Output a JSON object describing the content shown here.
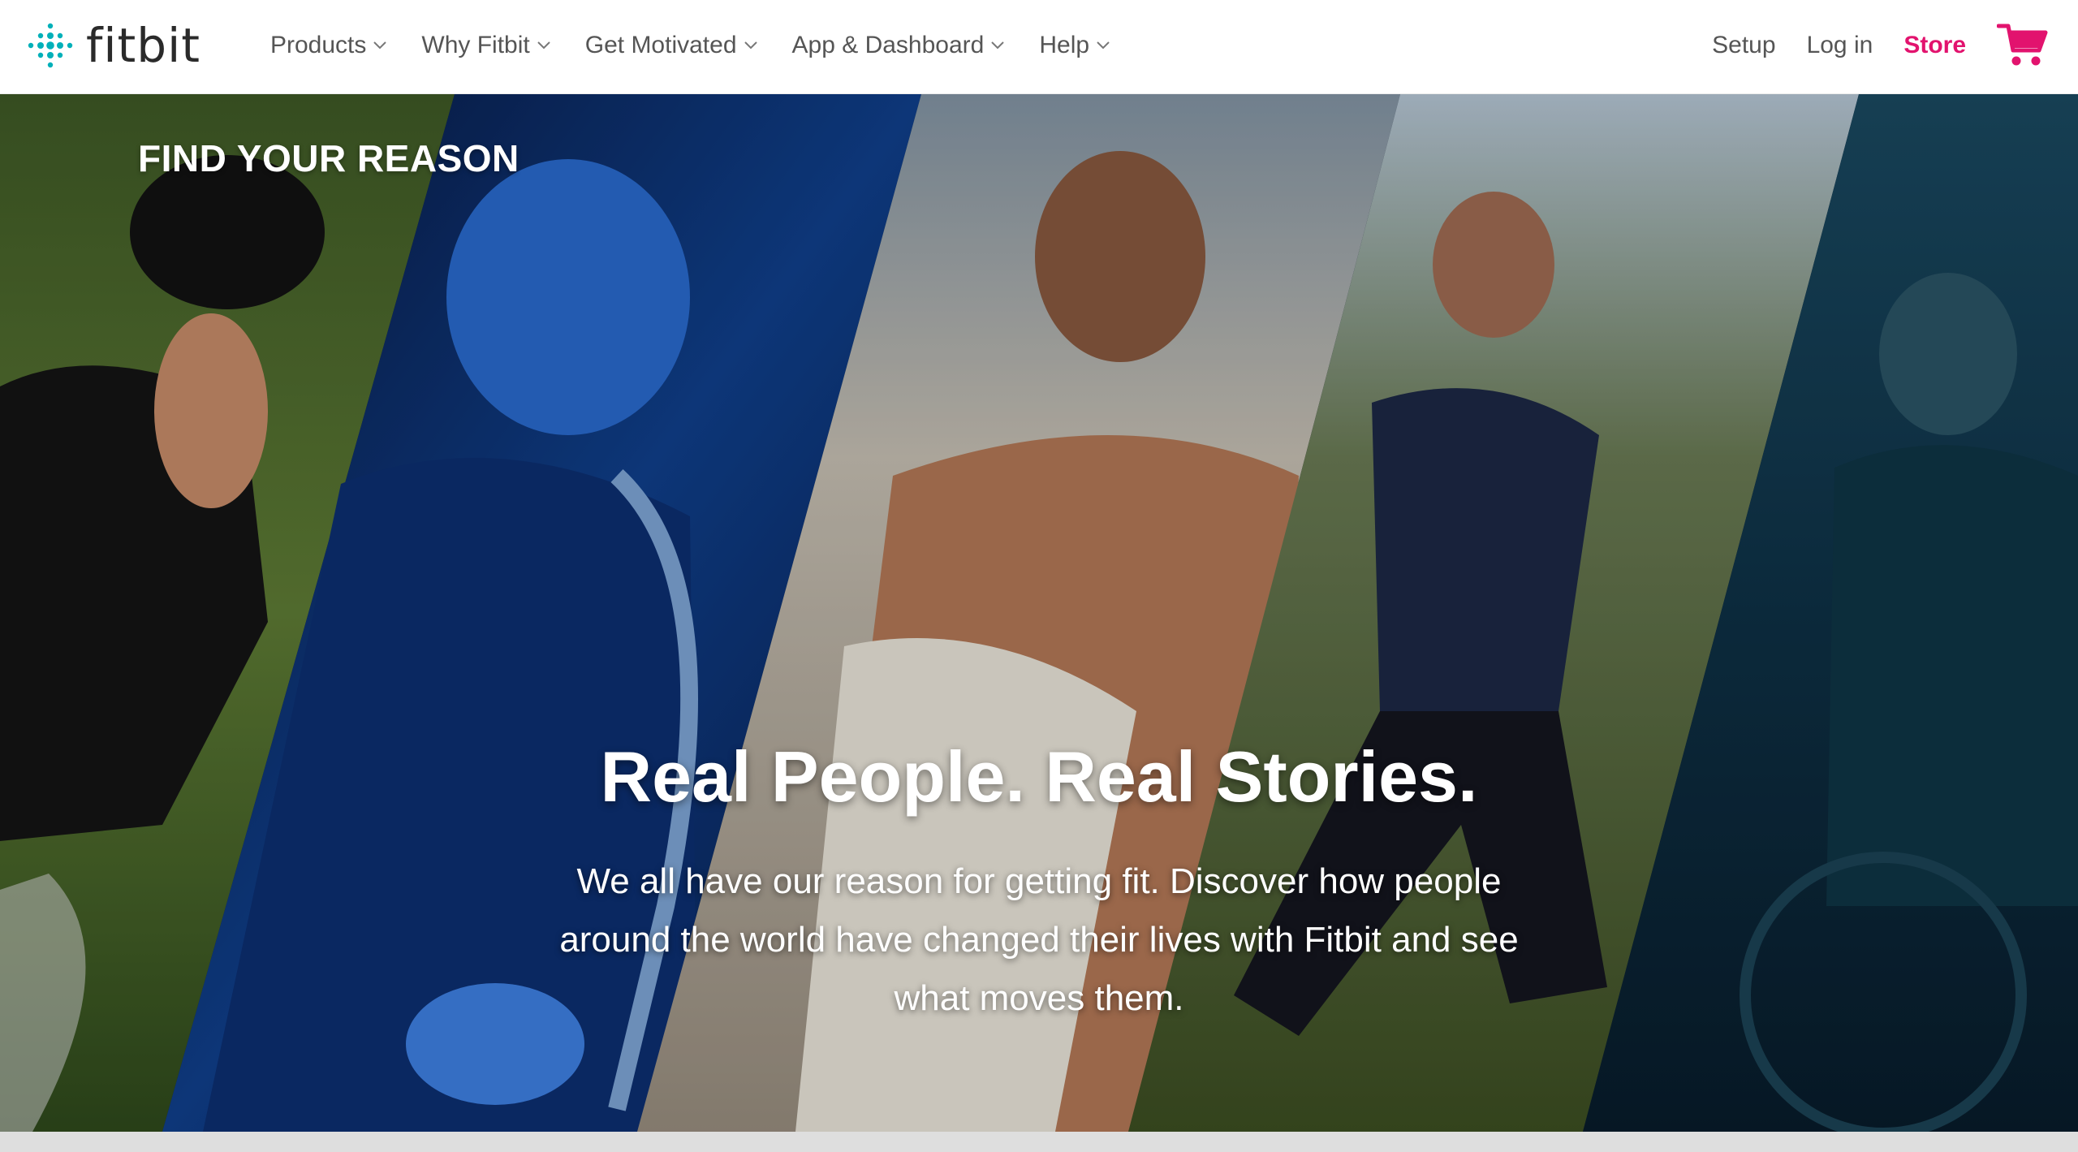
{
  "brand": {
    "name": "fitbit",
    "color": "#00b0b9"
  },
  "nav": {
    "items": [
      {
        "label": "Products"
      },
      {
        "label": "Why Fitbit"
      },
      {
        "label": "Get Motivated"
      },
      {
        "label": "App & Dashboard"
      },
      {
        "label": "Help"
      }
    ],
    "right": {
      "setup": "Setup",
      "login": "Log in",
      "store": "Store"
    },
    "store_color": "#e2136e",
    "cart_icon": "shopping-cart-icon",
    "dropdown_icon": "chevron-down-icon"
  },
  "hero": {
    "label": "FIND YOUR REASON",
    "title": "Real People. Real Stories.",
    "description": "We all have our reason for getting fit. Discover how people around the world have changed their lives with Fitbit and see what moves them.",
    "panels": [
      {
        "name": "cyclist-photo"
      },
      {
        "name": "saxophonist-photo"
      },
      {
        "name": "surfer-photo"
      },
      {
        "name": "runner-photo"
      },
      {
        "name": "wheelchair-athlete-photo"
      }
    ]
  }
}
